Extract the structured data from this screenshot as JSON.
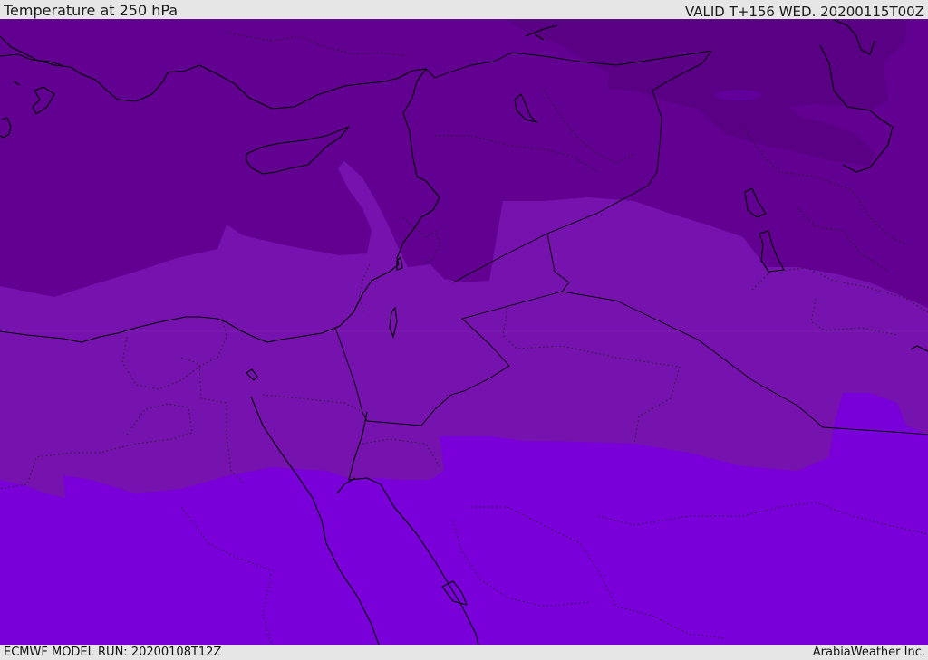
{
  "header": {
    "title": "Temperature at 250 hPa",
    "valid": "VALID T+156 WED. 20200115T00Z"
  },
  "footer": {
    "model_run": "ECMWF MODEL RUN: 20200108T12Z",
    "credit": "ArabiaWeather Inc."
  },
  "map": {
    "colors": {
      "band_coldest": "#590085",
      "band_cold": "#620091",
      "band_mid": "#7612ad",
      "band_warm": "#7a00d9"
    }
  }
}
